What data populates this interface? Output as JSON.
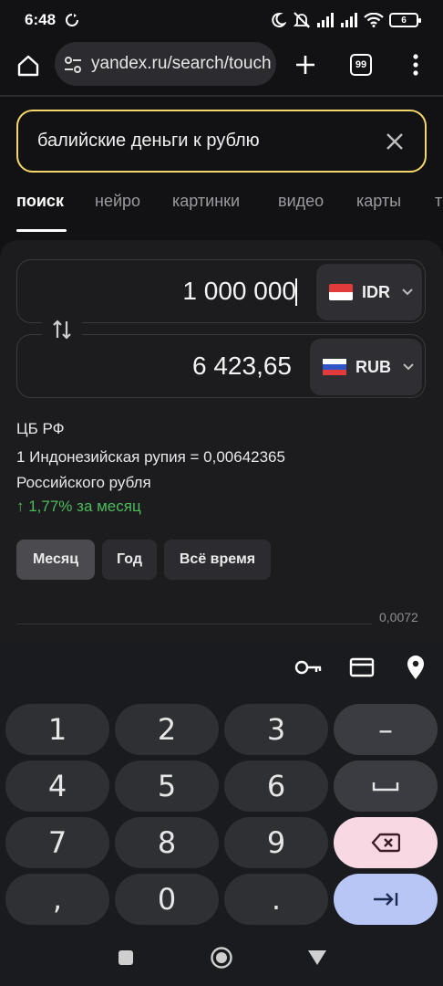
{
  "status": {
    "time": "6:48",
    "battery": "6"
  },
  "browser": {
    "url": "yandex.ru/search/touch",
    "tab_count": "99"
  },
  "search": {
    "query": "балийские деньги к рублю"
  },
  "tabs": [
    {
      "label": "поиск"
    },
    {
      "label": "нейро"
    },
    {
      "label": "картинки"
    },
    {
      "label": "видео"
    },
    {
      "label": "карты"
    },
    {
      "label": "т"
    }
  ],
  "converter": {
    "from": {
      "amount": "1 000 000",
      "code": "IDR"
    },
    "to": {
      "amount": "6 423,65",
      "code": "RUB"
    },
    "source": "ЦБ РФ",
    "rate_line1": "1 Индонезийская рупия = 0,00642365",
    "rate_line2": "Российского рубля",
    "change": "↑ 1,77% за месяц",
    "change_color": "#4cbb5a",
    "periods": [
      {
        "label": "Месяц",
        "active": true
      },
      {
        "label": "Год",
        "active": false
      },
      {
        "label": "Всё время",
        "active": false
      }
    ],
    "chart_max_label": "0,0072"
  },
  "keyboard": {
    "rows": [
      [
        "1",
        "2",
        "3",
        "–"
      ],
      [
        "4",
        "5",
        "6",
        "␣"
      ],
      [
        "7",
        "8",
        "9",
        "⌫"
      ],
      [
        ",",
        "0",
        ".",
        "⇥"
      ]
    ]
  }
}
